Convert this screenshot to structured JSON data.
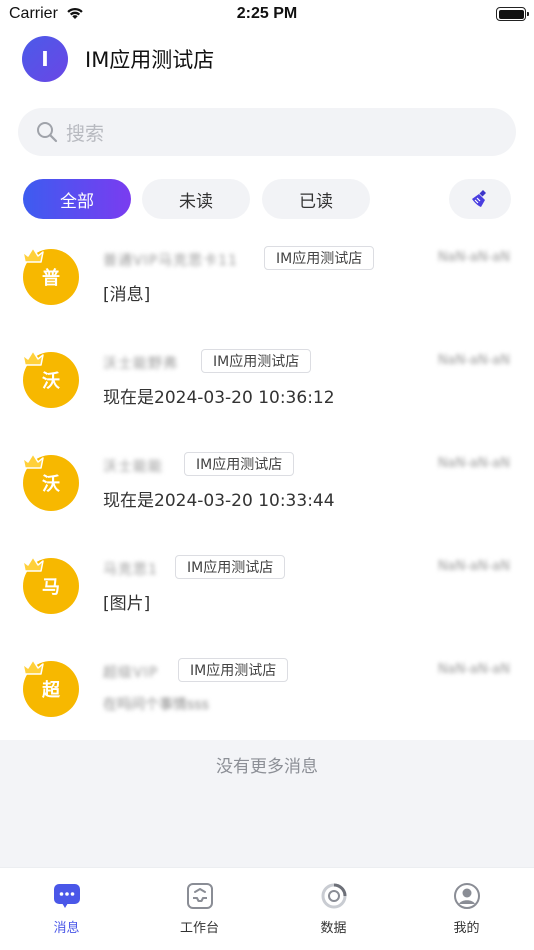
{
  "status_bar": {
    "carrier": "Carrier",
    "time": "2:25 PM"
  },
  "header": {
    "avatar_letter": "I",
    "store_name": "IM应用测试店"
  },
  "search": {
    "placeholder": "搜索"
  },
  "filters": {
    "all": "全部",
    "unread": "未读",
    "read": "已读"
  },
  "conversations": [
    {
      "avatar": "普",
      "name": "普通VIP马克思卡11",
      "store": "IM应用测试店",
      "time": "NaN-aN-aN",
      "message": "[消息]",
      "message_blurred": false
    },
    {
      "avatar": "沃",
      "name": "沃士能野弗",
      "store": "IM应用测试店",
      "time": "NaN-aN-aN",
      "message": "现在是2024-03-20 10:36:12",
      "message_blurred": false
    },
    {
      "avatar": "沃",
      "name": "沃士能能",
      "store": "IM应用测试店",
      "time": "NaN-aN-aN",
      "message": "现在是2024-03-20 10:33:44",
      "message_blurred": false
    },
    {
      "avatar": "马",
      "name": "马克思1",
      "store": "IM应用测试店",
      "time": "NaN-aN-aN",
      "message": "[图片]",
      "message_blurred": false
    },
    {
      "avatar": "超",
      "name": "超级VIP",
      "store": "IM应用测试店",
      "time": "NaN-aN-aN",
      "message": "在吗问个事情sss",
      "message_blurred": true
    }
  ],
  "footer": {
    "no_more": "没有更多消息"
  },
  "tabbar": {
    "messages": "消息",
    "workbench": "工作台",
    "data": "数据",
    "mine": "我的"
  },
  "colors": {
    "accent": "#4a57e8",
    "avatar_bg": "#f7b800",
    "tab_bg": "#f2f3f6"
  }
}
